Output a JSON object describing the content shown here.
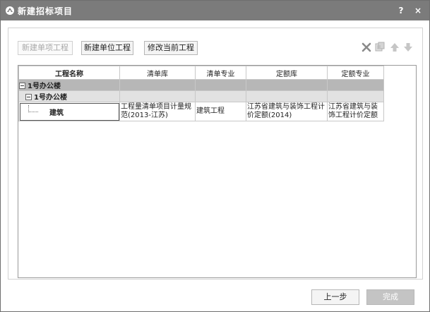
{
  "window": {
    "title": "新建招标项目",
    "help_label": "?",
    "close_label": "×"
  },
  "toolbar": {
    "new_single_label": "新建单项工程",
    "new_unit_label": "新建单位工程",
    "modify_label": "修改当前工程",
    "icons": [
      "delete-icon",
      "copy-icon",
      "move-up-icon",
      "move-down-icon"
    ]
  },
  "table": {
    "columns": [
      "工程名称",
      "清单库",
      "清单专业",
      "定额库",
      "定额专业"
    ],
    "rows": [
      {
        "name": "1号办公楼",
        "level": 0
      },
      {
        "name": "1号办公楼",
        "level": 1
      },
      {
        "name": "建筑",
        "level": 2,
        "qd_lib": "工程量清单项目计量规范(2013-江苏)",
        "qd_major": "建筑工程",
        "de_lib": "江苏省建筑与装饰工程计价定额(2014)",
        "de_major": "江苏省建筑与装饰工程计价定额"
      }
    ]
  },
  "footer": {
    "prev_label": "上一步",
    "finish_label": "完成"
  },
  "colors": {
    "titlebar": "#7b7b7b",
    "group_row": "#b7b7b7",
    "subgroup_row": "#e2e2e2"
  }
}
